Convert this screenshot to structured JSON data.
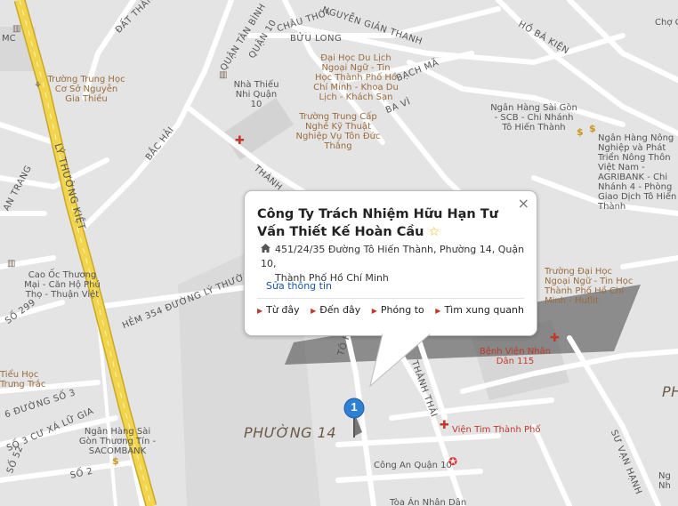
{
  "popup": {
    "title": "Công Ty Trách Nhiệm Hữu Hạn Tư Vấn Thiết Kế Hoàn Cầu",
    "address_line1": "451/24/35 Đường Tô Hiến Thành, Phường 14, Quận 10,",
    "address_line2": "Thành Phố Hồ Chí Minh",
    "edit_label": "Sửa thông tin",
    "close_label": "×",
    "actions": [
      "Từ đây",
      "Đến đây",
      "Phóng to",
      "Tìm xung quanh"
    ]
  },
  "marker": {
    "number": "1"
  },
  "streets": {
    "ly_thuong_kiet": "LÝ THƯỜNG KIỆT",
    "dat_thanh": "ĐẤT THÁNH",
    "quan_tan_binh": "QUẬN TÂN BÌNH",
    "quan_10": "QUẬN 10",
    "chau_thoi": "CHÂU THỚI",
    "nguyen_gian_thanh": "NGUYỄN GIẢN THANH",
    "buu_long": "BỬU LONG",
    "ho_ba_kien": "HỒ BÁ KIỆN",
    "bach_ma": "BẠCH MÃ",
    "ba_vi": "BA VÌ",
    "bac_hai": "BẮC HẢI",
    "thanh": "THÀNH",
    "an_trang": "AN TRANG",
    "so_299": "SỐ 299",
    "hem_354": "HẺM 354 ĐƯỜNG LÝ THƯỜNG KIỆT",
    "duong_so_3": "6 ĐƯỜNG SỐ 3",
    "cu_xa_lu_gia": "SỐ 3 CƯ XÁ LỮ GIA",
    "so_52": "SỐ 52",
    "so_2": "SỐ 2",
    "to_hien": "TÔ HI",
    "thanh_thai": "THÀNH THÁI",
    "su_van_hanh": "SƯ VẠN HẠNH"
  },
  "places": {
    "chq": "Chợ Chi",
    "mc": "MC",
    "truong_nguyen_gia_thieu": "Trường Trung Học Cơ Sở Nguyễn Gia Thiều",
    "dh_du_lich": "Đại Học Du Lịch Ngoại Ngữ - Tin Học Thành Phố Hồ Chí Minh - Khoa Du Lịch - Khách Sạn",
    "nha_thieu_nhi": "Nhà Thiếu Nhi Quận 10",
    "truong_ton_duc_thang": "Trường Trung Cấp Nghề Kỹ Thuật Nghiệp Vụ Tôn Đức Thắng",
    "scb": "Ngân Hàng Sài Gòn - SCB - Chi Nhánh Tô Hiến Thành",
    "agribank": "Ngân Hàng Nông Nghiệp và Phát Triển Nông Thôn Việt Nam - AGRIBANK - Chi Nhánh 4 - Phòng Giao Dịch Tô Hiến Thành",
    "cao_oc": "Cao Ốc Thương Mại - Căn Hộ Phú Thọ - Thuận Việt",
    "hutech": "Trường Đại Học Ngoại Ngữ - Tin Học Thành Phố Hồ Chí Minh - Huflit",
    "benh_vien_115": "Bệnh Viện Nhân Dân 115",
    "tieu_hoc": "Tiểu Học Trưng Trắc",
    "sacombank": "Ngân Hàng Sài Gòn Thương Tín - SACOMBANK",
    "vien_tim": "Viện Tim Thành Phố",
    "cong_an": "Công An Quận 10",
    "toa_an": "Tòa Án Nhân Dân",
    "phuong_14": "PHƯỜNG 14",
    "ph_right": "PH",
    "nh_right": "Ng Nh"
  },
  "colors": {
    "map_bg": "#e4e4e4",
    "road": "#ffffff",
    "main_road": "#f2d54e",
    "block": "#d6d6d6",
    "link": "#1a56a6",
    "marker": "#2f7fd3"
  },
  "icons": [
    "home-icon",
    "close-icon",
    "star-icon",
    "marker-pin-icon",
    "hospital-icon",
    "bank-icon",
    "police-icon"
  ]
}
